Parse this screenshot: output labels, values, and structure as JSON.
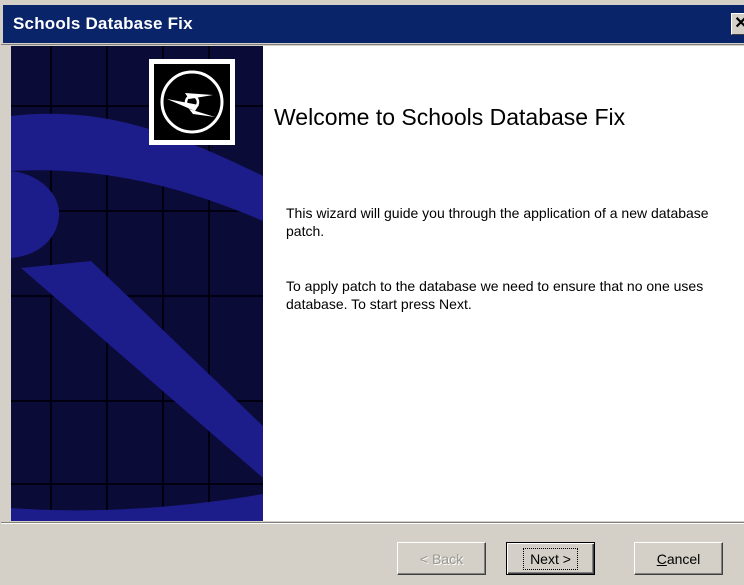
{
  "window": {
    "title": "Schools Database Fix",
    "close_glyph": "✕"
  },
  "wizard": {
    "heading": "Welcome to Schools Database Fix",
    "paragraph_1": "This wizard will guide you through the application of a new database patch.",
    "paragraph_2": "To apply patch to the database we need to ensure that no one uses database. To start press Next."
  },
  "buttons": {
    "back": "< Back",
    "next": "Next >",
    "cancel": "Cancel"
  },
  "icons": {
    "banner_icon": "cd-disc-icon",
    "close_icon": "close-icon"
  },
  "colors": {
    "titlebar": "#0a246a",
    "banner_dark": "#0b0b38",
    "banner_blue": "#1c1c8a",
    "dialog_face": "#d4d0c8"
  }
}
